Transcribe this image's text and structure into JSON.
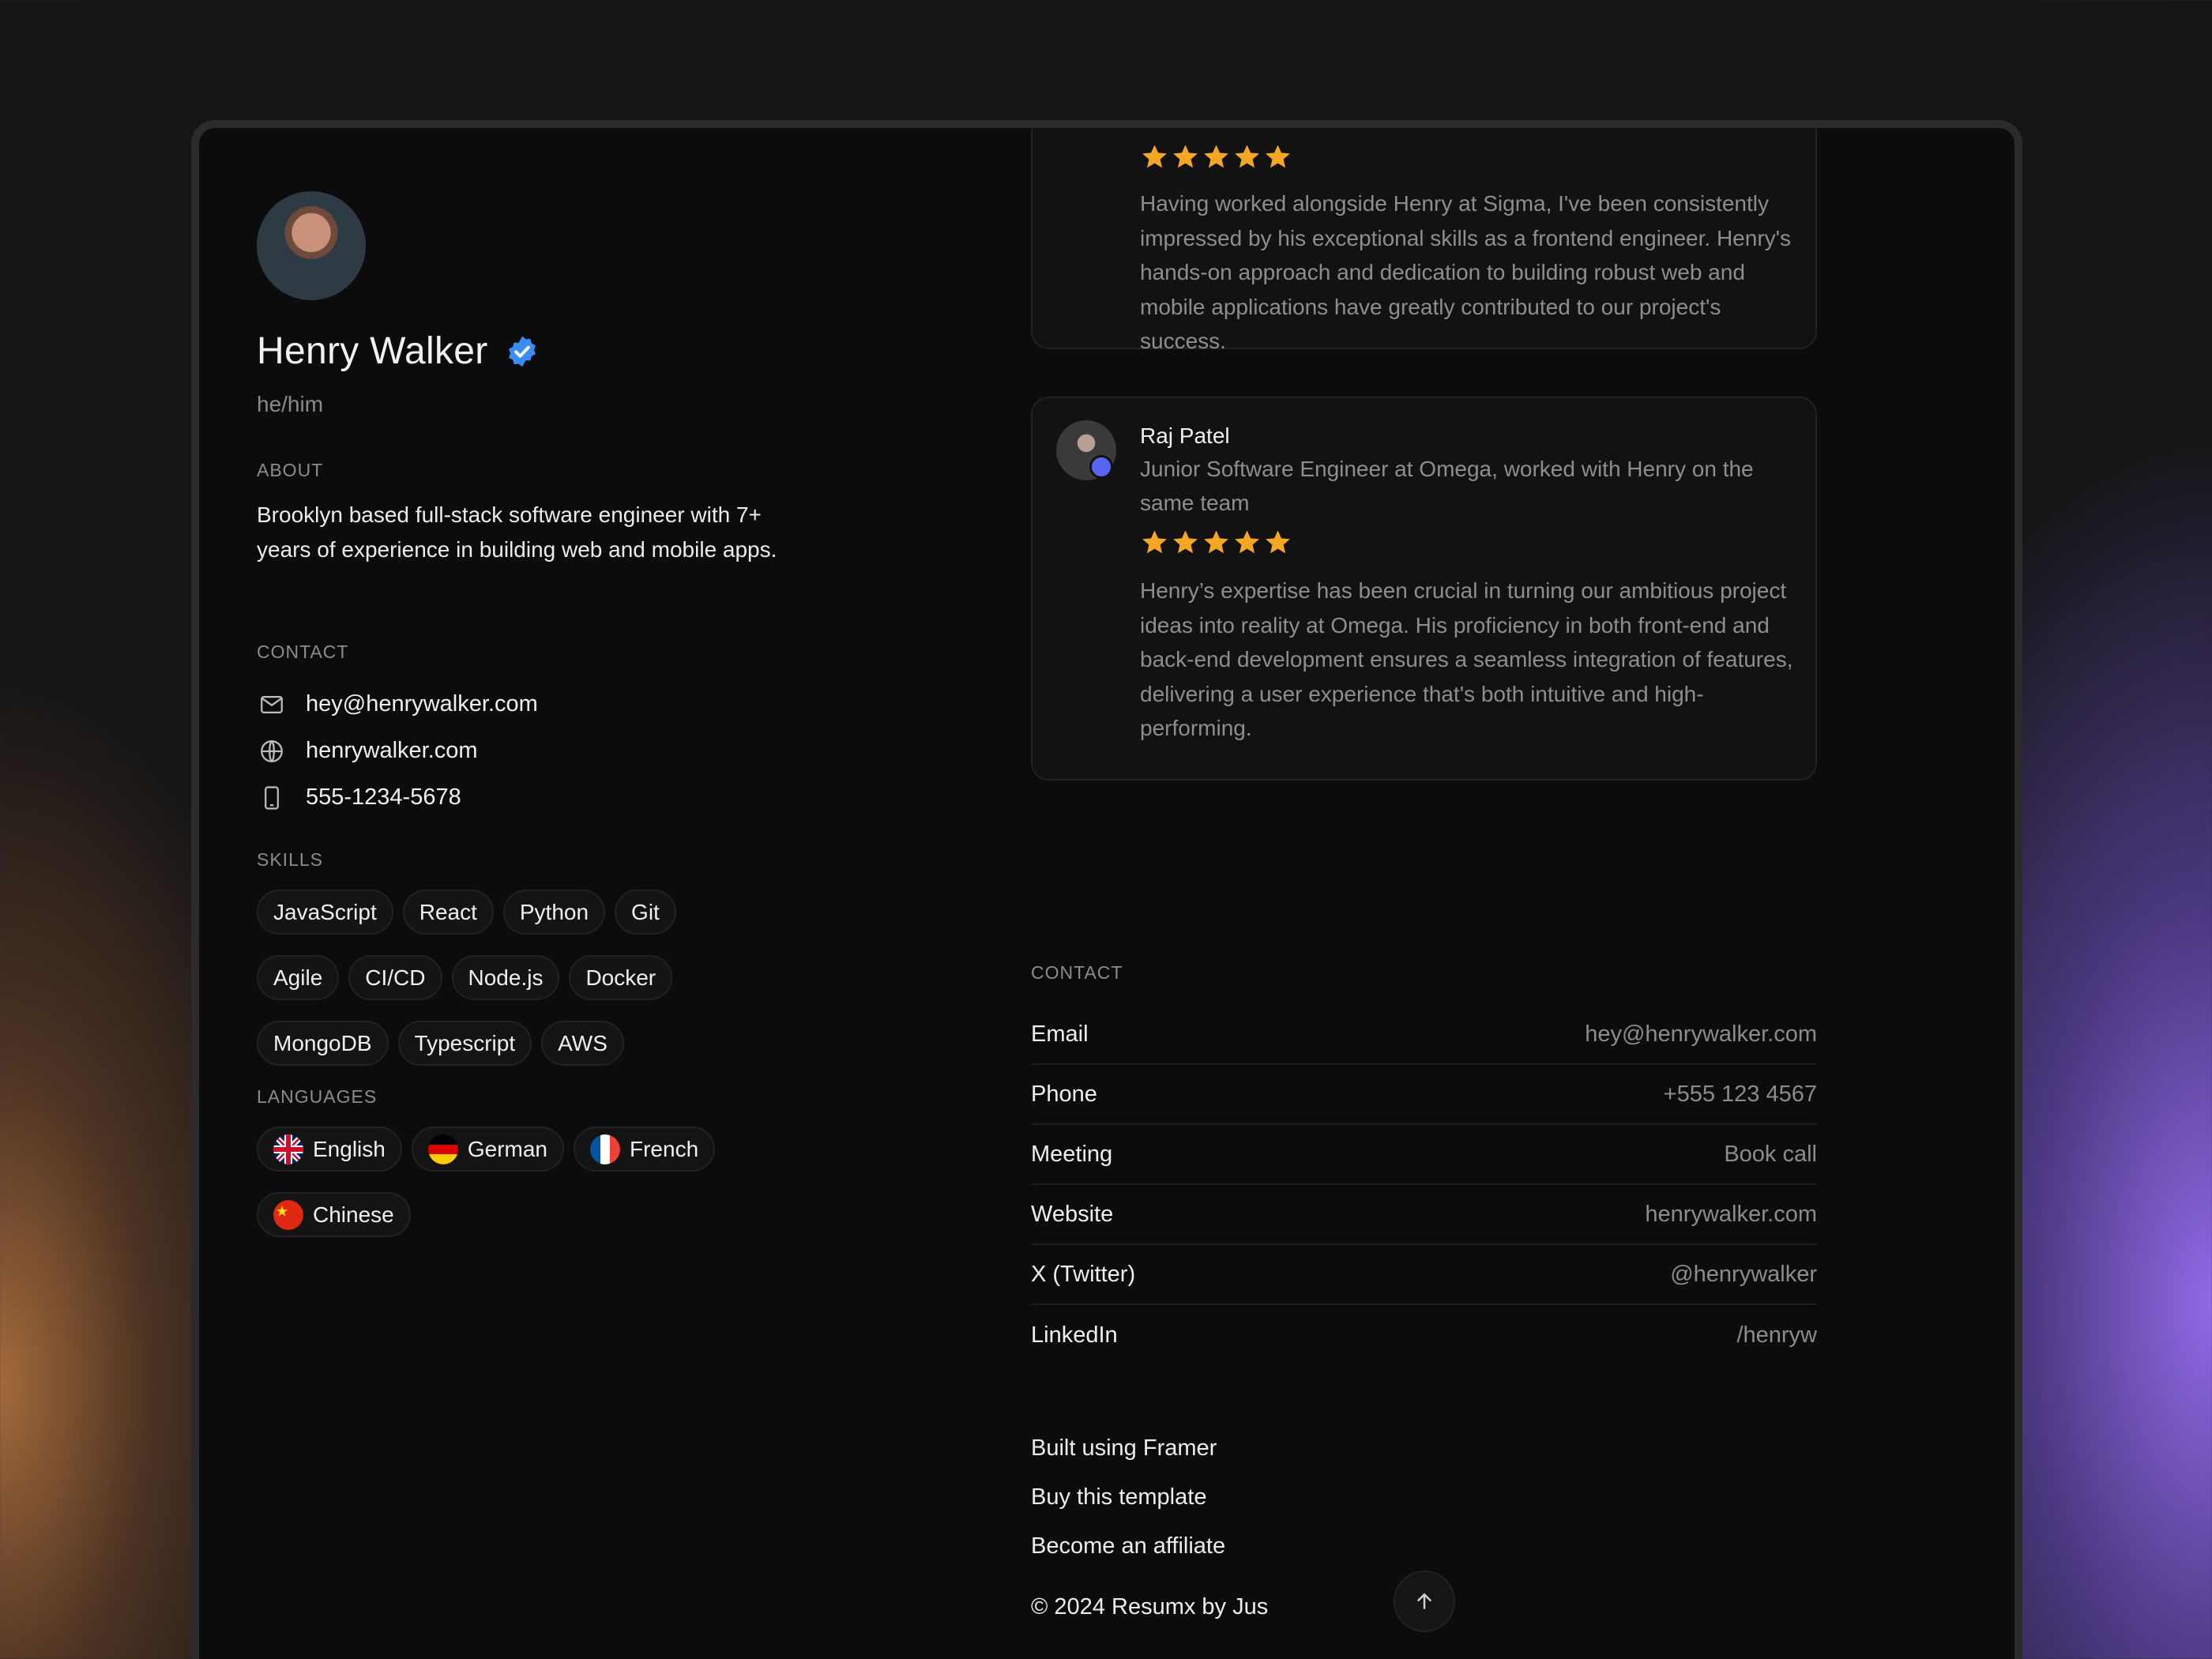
{
  "profile": {
    "name": "Henry Walker",
    "pronouns": "he/him"
  },
  "about": {
    "label": "ABOUT",
    "text": "Brooklyn based full-stack software engineer with 7+ years of experience in building web and mobile apps."
  },
  "contact_left": {
    "label": "CONTACT",
    "items": [
      {
        "icon": "mail-icon",
        "text": "hey@henrywalker.com"
      },
      {
        "icon": "globe-icon",
        "text": "henrywalker.com"
      },
      {
        "icon": "phone-icon",
        "text": "555-1234-5678"
      }
    ]
  },
  "skills": {
    "label": "SKILLS",
    "items": [
      "JavaScript",
      "React",
      "Python",
      "Git",
      "Agile",
      "CI/CD",
      "Node.js",
      "Docker",
      "MongoDB",
      "Typescript",
      "AWS"
    ]
  },
  "languages": {
    "label": "LANGUAGES",
    "items": [
      "English",
      "German",
      "French",
      "Chinese"
    ]
  },
  "reviews": [
    {
      "rating": 5,
      "text": "Having worked alongside Henry at Sigma, I've been consistently impressed by his exceptional skills as a frontend engineer. Henry's hands-on approach and dedication to building robust web and mobile applications have greatly contributed to our project's success."
    },
    {
      "name": "Raj Patel",
      "role": "Junior Software Engineer at Omega, worked with Henry on the same team",
      "rating": 5,
      "text": "Henry’s expertise has been crucial in turning our ambitious project ideas into reality at Omega. His proficiency in both front-end and back-end development ensures a seamless integration of features, delivering a user experience that's both intuitive and high-performing."
    }
  ],
  "contact_right": {
    "label": "CONTACT",
    "rows": [
      {
        "key": "Email",
        "value": "hey@henrywalker.com"
      },
      {
        "key": "Phone",
        "value": "+555 123 4567"
      },
      {
        "key": "Meeting",
        "value": "Book call"
      },
      {
        "key": "Website",
        "value": "henrywalker.com"
      },
      {
        "key": "X (Twitter)",
        "value": "@henrywalker"
      },
      {
        "key": "LinkedIn",
        "value": "/henryw"
      }
    ]
  },
  "footer": {
    "links": [
      "Built using Framer",
      "Buy this template",
      "Become an affiliate"
    ],
    "copyright": "© 2024 Resumx by Jus"
  },
  "colors": {
    "star": "#f5a623",
    "verified": "#3b8cf5",
    "background": "#0c0c0c"
  }
}
